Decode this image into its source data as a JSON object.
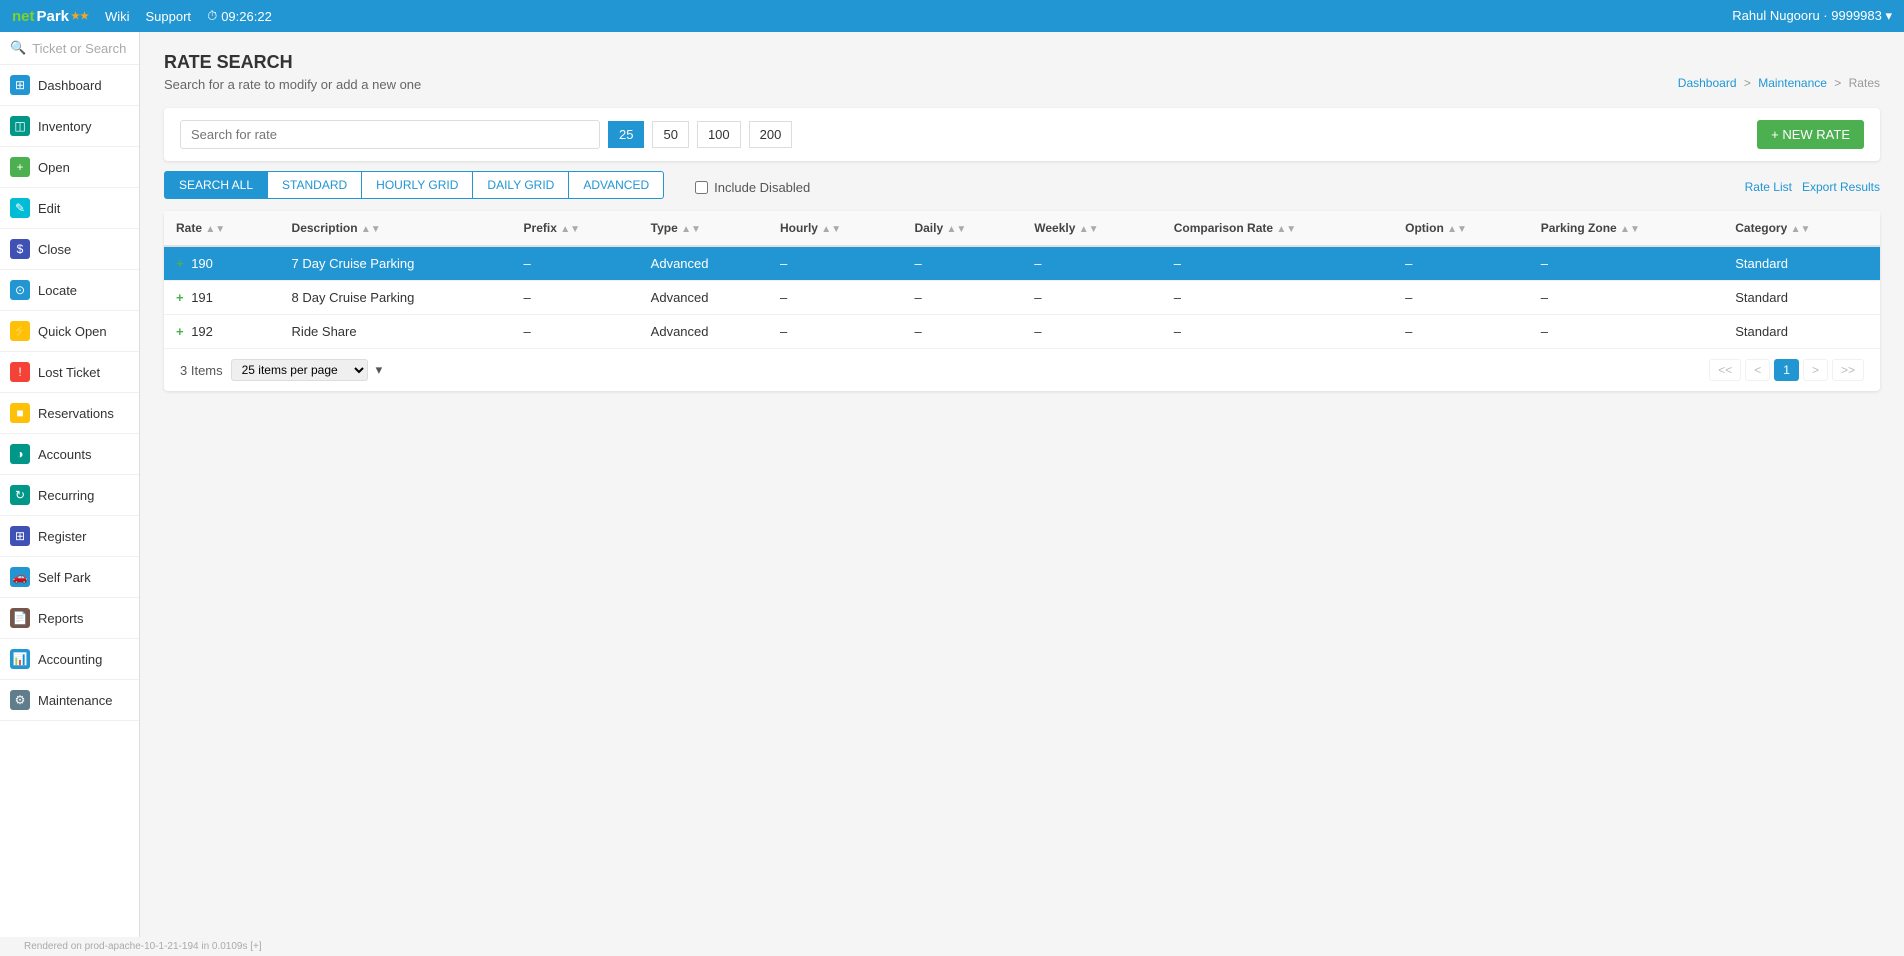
{
  "topNav": {
    "logo": "netPark",
    "logoNet": "net",
    "logoPark": "Park",
    "wikiLabel": "Wiki",
    "supportLabel": "Support",
    "time": "09:26:22",
    "user": "Rahul Nugooru · 9999983 ▾"
  },
  "sidebar": {
    "searchPlaceholder": "Ticket or Search",
    "items": [
      {
        "label": "Dashboard",
        "icon": "⊞",
        "iconClass": "icon-blue"
      },
      {
        "label": "Inventory",
        "icon": "📦",
        "iconClass": "icon-teal"
      },
      {
        "label": "Open",
        "icon": "+",
        "iconClass": "icon-green"
      },
      {
        "label": "Edit",
        "icon": "✎",
        "iconClass": "icon-cyan"
      },
      {
        "label": "Close",
        "icon": "$",
        "iconClass": "icon-indigo"
      },
      {
        "label": "Locate",
        "icon": "⊙",
        "iconClass": "icon-blue"
      },
      {
        "label": "Quick Open",
        "icon": "⚡",
        "iconClass": "icon-amber"
      },
      {
        "label": "Lost Ticket",
        "icon": "!",
        "iconClass": "icon-red"
      },
      {
        "label": "Reservations",
        "icon": "■",
        "iconClass": "icon-amber"
      },
      {
        "label": "Accounts",
        "icon": "◑",
        "iconClass": "icon-teal"
      },
      {
        "label": "Recurring",
        "icon": "↻",
        "iconClass": "icon-teal"
      },
      {
        "label": "Register",
        "icon": "⊞",
        "iconClass": "icon-indigo"
      },
      {
        "label": "Self Park",
        "icon": "🚗",
        "iconClass": "icon-blue"
      },
      {
        "label": "Reports",
        "icon": "📄",
        "iconClass": "icon-brown"
      },
      {
        "label": "Accounting",
        "icon": "📊",
        "iconClass": "icon-blue"
      },
      {
        "label": "Maintenance",
        "icon": "⚙",
        "iconClass": "icon-gray"
      }
    ]
  },
  "page": {
    "title": "RATE SEARCH",
    "subtitle": "Search for a rate to modify or add a new one",
    "breadcrumb": {
      "parts": [
        "Dashboard",
        "Maintenance",
        "Rates"
      ],
      "separators": [
        ">",
        ">"
      ]
    }
  },
  "searchBar": {
    "placeholder": "Search for rate",
    "pageSizes": [
      "25",
      "50",
      "100",
      "200"
    ],
    "activePage": "25",
    "newRateLabel": "+ NEW RATE"
  },
  "filterTabs": {
    "tabs": [
      "SEARCH ALL",
      "STANDARD",
      "HOURLY GRID",
      "DAILY GRID",
      "ADVANCED"
    ],
    "active": "SEARCH ALL",
    "includeDisabled": "Include Disabled"
  },
  "topLinks": {
    "rateList": "Rate List",
    "exportResults": "Export Results"
  },
  "table": {
    "columns": [
      {
        "label": "Rate",
        "sortable": true
      },
      {
        "label": "Description",
        "sortable": true
      },
      {
        "label": "Prefix",
        "sortable": true
      },
      {
        "label": "Type",
        "sortable": true
      },
      {
        "label": "Hourly",
        "sortable": true
      },
      {
        "label": "Daily",
        "sortable": true
      },
      {
        "label": "Weekly",
        "sortable": true
      },
      {
        "label": "Comparison Rate",
        "sortable": true
      },
      {
        "label": "Option",
        "sortable": true
      },
      {
        "label": "Parking Zone",
        "sortable": true
      },
      {
        "label": "Category",
        "sortable": true
      }
    ],
    "rows": [
      {
        "id": "190",
        "description": "7 Day Cruise Parking",
        "prefix": "–",
        "type": "Advanced",
        "hourly": "–",
        "daily": "–",
        "weekly": "–",
        "comparisonRate": "–",
        "option": "–",
        "parkingZone": "–",
        "category": "Standard",
        "selected": true
      },
      {
        "id": "191",
        "description": "8 Day Cruise Parking",
        "prefix": "–",
        "type": "Advanced",
        "hourly": "–",
        "daily": "–",
        "weekly": "–",
        "comparisonRate": "–",
        "option": "–",
        "parkingZone": "–",
        "category": "Standard",
        "selected": false
      },
      {
        "id": "192",
        "description": "Ride Share",
        "prefix": "–",
        "type": "Advanced",
        "hourly": "–",
        "daily": "–",
        "weekly": "–",
        "comparisonRate": "–",
        "option": "–",
        "parkingZone": "–",
        "category": "Standard",
        "selected": false
      }
    ]
  },
  "pagination": {
    "itemCount": "3 Items",
    "perPage": "25 items per page",
    "currentPage": "1",
    "prevDisabled": true,
    "nextDisabled": true,
    "firstDisabled": true,
    "lastDisabled": true
  },
  "footer": {
    "text": "Rendered on prod-apache-10-1-21-194 in 0.0109s [+]"
  }
}
